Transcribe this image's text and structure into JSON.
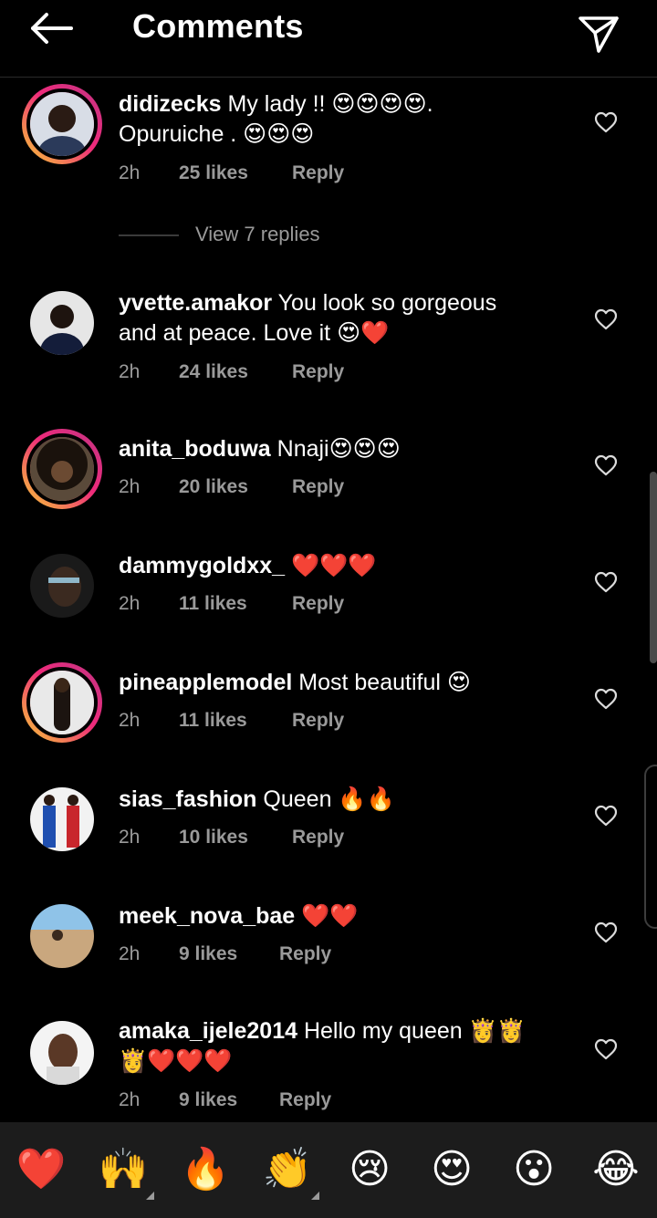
{
  "header": {
    "title": "Comments"
  },
  "comments": [
    {
      "username": "didizecks",
      "text_line1": "My lady !! 😍😍😍😍.",
      "text_line2": "Opuruiche . 😍😍😍",
      "time": "2h",
      "likes": "25 likes",
      "reply": "Reply",
      "story_ring": true
    },
    {
      "username": "yvette.amakor",
      "text_line1": "You look so gorgeous",
      "text_line2": "and at peace. Love it 😍❤️",
      "time": "2h",
      "likes": "24 likes",
      "reply": "Reply",
      "story_ring": false
    },
    {
      "username": "anita_boduwa",
      "text_line1": "Nnaji😍😍😍",
      "time": "2h",
      "likes": "20 likes",
      "reply": "Reply",
      "story_ring": true
    },
    {
      "username": "dammygoldxx_",
      "text_line1": "❤️❤️❤️",
      "time": "2h",
      "likes": "11 likes",
      "reply": "Reply",
      "story_ring": false
    },
    {
      "username": "pineapplemodel",
      "text_line1": "Most beautiful 😍",
      "time": "2h",
      "likes": "11 likes",
      "reply": "Reply",
      "story_ring": true
    },
    {
      "username": "sias_fashion",
      "text_line1": "Queen 🔥🔥",
      "time": "2h",
      "likes": "10 likes",
      "reply": "Reply",
      "story_ring": false
    },
    {
      "username": "meek_nova_bae",
      "text_line1": "❤️❤️",
      "time": "2h",
      "likes": "9 likes",
      "reply": "Reply",
      "story_ring": false
    },
    {
      "username": "amaka_ijele2014",
      "text_line1": "Hello my queen 👸👸",
      "text_line2": "👸❤️❤️❤️",
      "time": "2h",
      "likes": "9 likes",
      "reply": "Reply",
      "story_ring": false
    }
  ],
  "view_replies": "View 7 replies",
  "emoji_bar": [
    "❤️",
    "🙌",
    "🔥",
    "👏",
    "😢",
    "😍",
    "😮",
    "😂"
  ],
  "icons": {
    "back": "back-arrow-icon",
    "send": "send-paper-plane-icon",
    "like": "heart-outline-icon"
  },
  "colors": {
    "background": "#000000",
    "secondary_text": "#9a9a9a",
    "story_ring_start": "#f9ce34",
    "story_ring_end": "#c13584",
    "emoji_bar_bg": "#1c1c1c"
  }
}
